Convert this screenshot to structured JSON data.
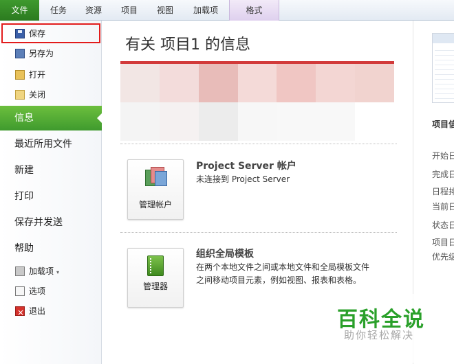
{
  "ribbon": {
    "tabs": [
      {
        "label": "文件"
      },
      {
        "label": "任务"
      },
      {
        "label": "资源"
      },
      {
        "label": "项目"
      },
      {
        "label": "视图"
      },
      {
        "label": "加载项"
      },
      {
        "label": "格式"
      }
    ]
  },
  "backstage": {
    "commands": [
      {
        "label": "保存",
        "icon": "save-icon"
      },
      {
        "label": "另存为",
        "icon": "save-as-icon"
      },
      {
        "label": "打开",
        "icon": "open-folder-icon"
      },
      {
        "label": "关闭",
        "icon": "close-folder-icon"
      }
    ],
    "tabs": [
      {
        "label": "信息"
      },
      {
        "label": "最近所用文件"
      },
      {
        "label": "新建"
      },
      {
        "label": "打印"
      },
      {
        "label": "保存并发送"
      },
      {
        "label": "帮助"
      }
    ],
    "bottom_commands": [
      {
        "label": "加载项",
        "icon": "add-ins-icon"
      },
      {
        "label": "选项",
        "icon": "options-icon"
      },
      {
        "label": "退出",
        "icon": "exit-icon"
      }
    ]
  },
  "info": {
    "title": "有关 项目1 的信息",
    "project_server": {
      "button_label": "管理帐户",
      "heading": "Project Server 帐户",
      "description": "未连接到 Project Server"
    },
    "global_template": {
      "button_label": "管理器",
      "heading": "组织全局模板",
      "description_line1": "在两个本地文件之间或本地文件和全局模板文件",
      "description_line2": "之间移动项目元素，例如视图、报表和表格。"
    }
  },
  "right_panel": {
    "heading": "项目信",
    "labels": [
      "开始日",
      "完成日",
      "日程排",
      "当前日",
      "状态日",
      "项目日",
      "优先级"
    ]
  },
  "watermark": {
    "line1": "百科全说",
    "line2": "助你轻松解决"
  },
  "colors": {
    "file_tab": "#3f9a2e",
    "active_tab": "#4faa34",
    "highlight_border": "#e21b1b",
    "redbar": "#d23a3a"
  }
}
